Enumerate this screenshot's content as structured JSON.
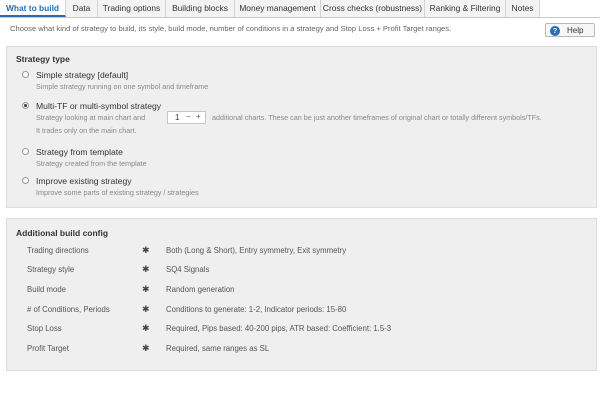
{
  "tabs": [
    {
      "label": "What to build",
      "active": true
    },
    {
      "label": "Data"
    },
    {
      "label": "Trading options"
    },
    {
      "label": "Building blocks"
    },
    {
      "label": "Money management"
    },
    {
      "label": "Cross checks (robustness)"
    },
    {
      "label": "Ranking & Filtering"
    },
    {
      "label": "Notes"
    }
  ],
  "description": "Choose what kind of strategy to build, its style, build mode, number of conditions in a strategy and Stop Loss + Profit Target ranges.",
  "help": {
    "label": "Help",
    "icon": "?"
  },
  "strategy_type": {
    "title": "Strategy type",
    "options": [
      {
        "label": "Simple strategy [default]",
        "sub": "Simple strategy running on one symbol and timeframe",
        "checked": false
      },
      {
        "label": "Multi-TF or multi-symbol strategy",
        "sub_prefix": "Strategy looking at main chart and",
        "stepper_value": "1",
        "sub_suffix": "additional charts. These can be just another timeframes of original chart or totally different symbols/TFs.",
        "sub2": "It trades only on the main chart.",
        "checked": true
      },
      {
        "label": "Strategy from template",
        "sub": "Strategy created from the template",
        "checked": false
      },
      {
        "label": "Improve existing strategy",
        "sub": "Improve some parts of existing strategy / strategies",
        "checked": false
      }
    ]
  },
  "build_config": {
    "title": "Additional build config",
    "rows": [
      {
        "name": "Trading directions",
        "value": "Both (Long & Short), Entry symmetry, Exit symmetry"
      },
      {
        "name": "Strategy style",
        "value": "SQ4 Signals"
      },
      {
        "name": "Build mode",
        "value": "Random generation"
      },
      {
        "name": "# of Conditions, Periods",
        "value": "Conditions to generate: 1-2, Indicator periods: 15-80"
      },
      {
        "name": "Stop Loss",
        "value": "Required, Pips based: 40-200 pips, ATR based: Coefficient: 1.5-3"
      },
      {
        "name": "Profit Target",
        "value": "Required, same ranges as SL"
      }
    ]
  },
  "colors": {
    "accent": "#2b6cb0",
    "panel": "#efefef"
  }
}
